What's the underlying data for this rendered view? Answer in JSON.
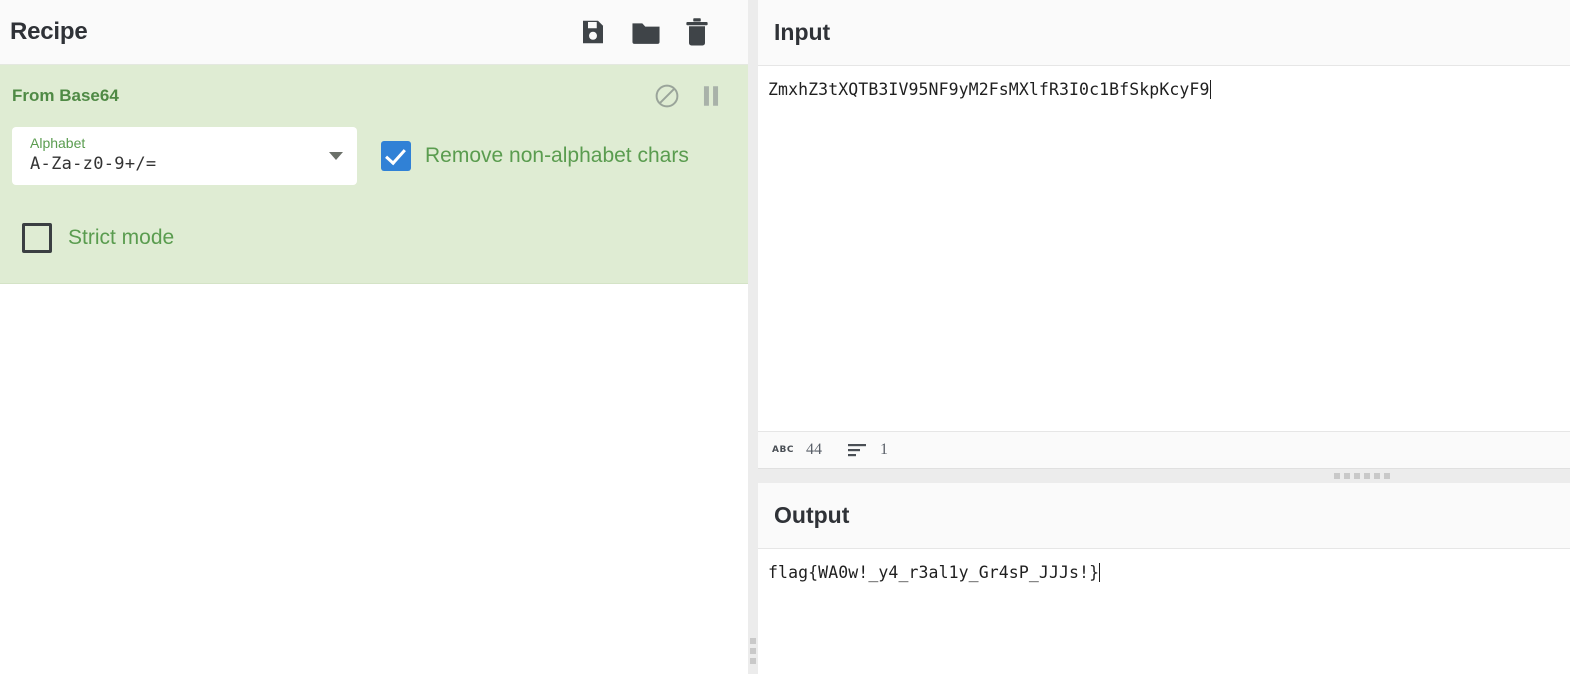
{
  "recipe": {
    "title": "Recipe",
    "toolbar": [
      {
        "name": "save-recipe-button",
        "icon": "save-icon"
      },
      {
        "name": "load-recipe-button",
        "icon": "folder-icon"
      },
      {
        "name": "clear-recipe-button",
        "icon": "trash-icon"
      }
    ],
    "operation": {
      "name": "From Base64",
      "controls": [
        {
          "name": "disable-operation-icon",
          "icon": "circle-slash-icon"
        },
        {
          "name": "pause-operation-icon",
          "icon": "pause-icon"
        }
      ],
      "args": {
        "alphabet_label": "Alphabet",
        "alphabet_value": "A-Za-z0-9+/=",
        "remove_non_alphabet_label": "Remove non-alphabet chars",
        "remove_non_alphabet_checked": true,
        "strict_mode_label": "Strict mode",
        "strict_mode_checked": false
      }
    }
  },
  "input": {
    "title": "Input",
    "value": "ZmxhZ3tXQTB3IV95NF9yM2FsMXlfR3I0c1BfSkpKcyF9",
    "status": {
      "length_icon": "ABC",
      "length": "44",
      "lines_icon": "lines-icon",
      "lines": "1"
    }
  },
  "output": {
    "title": "Output",
    "value": "flag{WA0w!_y4_r3al1y_Gr4sP_JJJs!}"
  },
  "colors": {
    "operation_bg": "#dfecd3",
    "operation_text": "#4f8a45",
    "checkbox_checked": "#3081d6",
    "panel_header_bg": "#fafafa"
  }
}
